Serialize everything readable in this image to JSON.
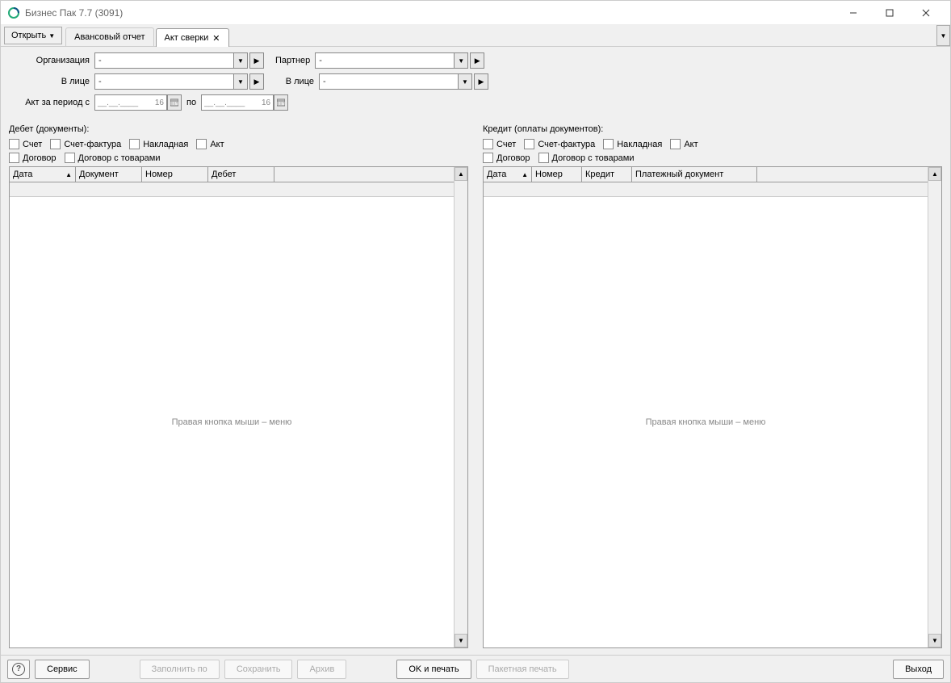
{
  "window": {
    "title": "Бизнес Пак 7.7 (3091)"
  },
  "toolbar": {
    "open_label": "Открыть",
    "tabs": [
      {
        "label": "Авансовый отчет",
        "active": false,
        "closable": false
      },
      {
        "label": "Акт сверки",
        "active": true,
        "closable": true
      }
    ]
  },
  "form": {
    "org_label": "Организация",
    "org_value": "-",
    "partner_label": "Партнер",
    "partner_value": "-",
    "person_left_label": "В лице",
    "person_left_value": "-",
    "person_right_label": "В лице",
    "person_right_value": "-",
    "period_label": "Акт за период с",
    "date_from": "__.__.____",
    "date_from_suffix": "16",
    "period_to_label": "по",
    "date_to": "__.__.____",
    "date_to_suffix": "16"
  },
  "debit": {
    "title": "Дебет (документы):",
    "checks1": [
      "Счет",
      "Счет-фактура",
      "Накладная",
      "Акт"
    ],
    "checks2": [
      "Договор",
      "Договор с товарами"
    ],
    "columns": [
      "Дата",
      "Документ",
      "Номер",
      "Дебет"
    ],
    "placeholder": "Правая кнопка мыши – меню"
  },
  "credit": {
    "title": "Кредит (оплаты документов):",
    "checks1": [
      "Счет",
      "Счет-фактура",
      "Накладная",
      "Акт"
    ],
    "checks2": [
      "Договор",
      "Договор с товарами"
    ],
    "columns": [
      "Дата",
      "Номер",
      "Кредит",
      "Платежный документ"
    ],
    "placeholder": "Правая кнопка мыши – меню"
  },
  "footer": {
    "service": "Сервис",
    "fill": "Заполнить по",
    "save": "Сохранить",
    "archive": "Архив",
    "ok_print": "OK и печать",
    "batch_print": "Пакетная печать",
    "exit": "Выход"
  }
}
